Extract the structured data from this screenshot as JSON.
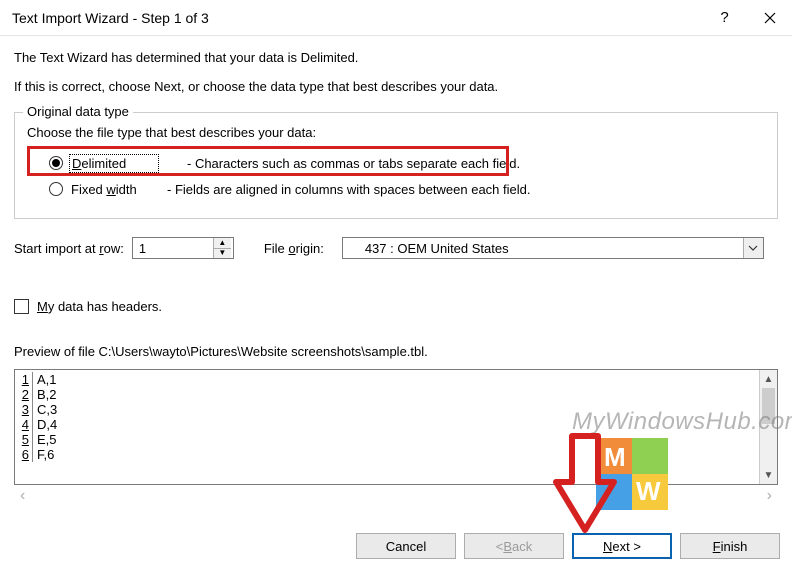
{
  "titlebar": {
    "title": "Text Import Wizard - Step 1 of 3"
  },
  "intro": {
    "line1": "The Text Wizard has determined that your data is Delimited.",
    "line2": "If this is correct, choose Next, or choose the data type that best describes your data."
  },
  "group": {
    "legend": "Original data type",
    "prompt": "Choose the file type that best describes your data:",
    "delimited": {
      "label_pre": "D",
      "label_rest": "elimited",
      "desc": "- Characters such as commas or tabs separate each field."
    },
    "fixed": {
      "label_pre": "Fixed ",
      "label_ul": "w",
      "label_rest": "idth",
      "desc": "- Fields are aligned in columns with spaces between each field."
    }
  },
  "start_row": {
    "label_pre": "Start import at ",
    "label_ul": "r",
    "label_rest": "ow:",
    "value": "1"
  },
  "origin": {
    "label_pre": "File ",
    "label_ul": "o",
    "label_rest": "rigin:",
    "value": "437 : OEM United States"
  },
  "headers_chk": {
    "label_ul": "M",
    "label_rest": "y data has headers."
  },
  "preview": {
    "label": "Preview of file C:\\Users\\wayto\\Pictures\\Website screenshots\\sample.tbl.",
    "rows": [
      {
        "n": "1",
        "t": "A,1"
      },
      {
        "n": "2",
        "t": "B,2"
      },
      {
        "n": "3",
        "t": "C,3"
      },
      {
        "n": "4",
        "t": "D,4"
      },
      {
        "n": "5",
        "t": "E,5"
      },
      {
        "n": "6",
        "t": "F,6"
      }
    ]
  },
  "buttons": {
    "cancel": "Cancel",
    "back_pre": "< ",
    "back_ul": "B",
    "back_rest": "ack",
    "next_ul": "N",
    "next_rest": "ext >",
    "finish_ul": "F",
    "finish_rest": "inish"
  },
  "watermark": "MyWindowsHub.com"
}
